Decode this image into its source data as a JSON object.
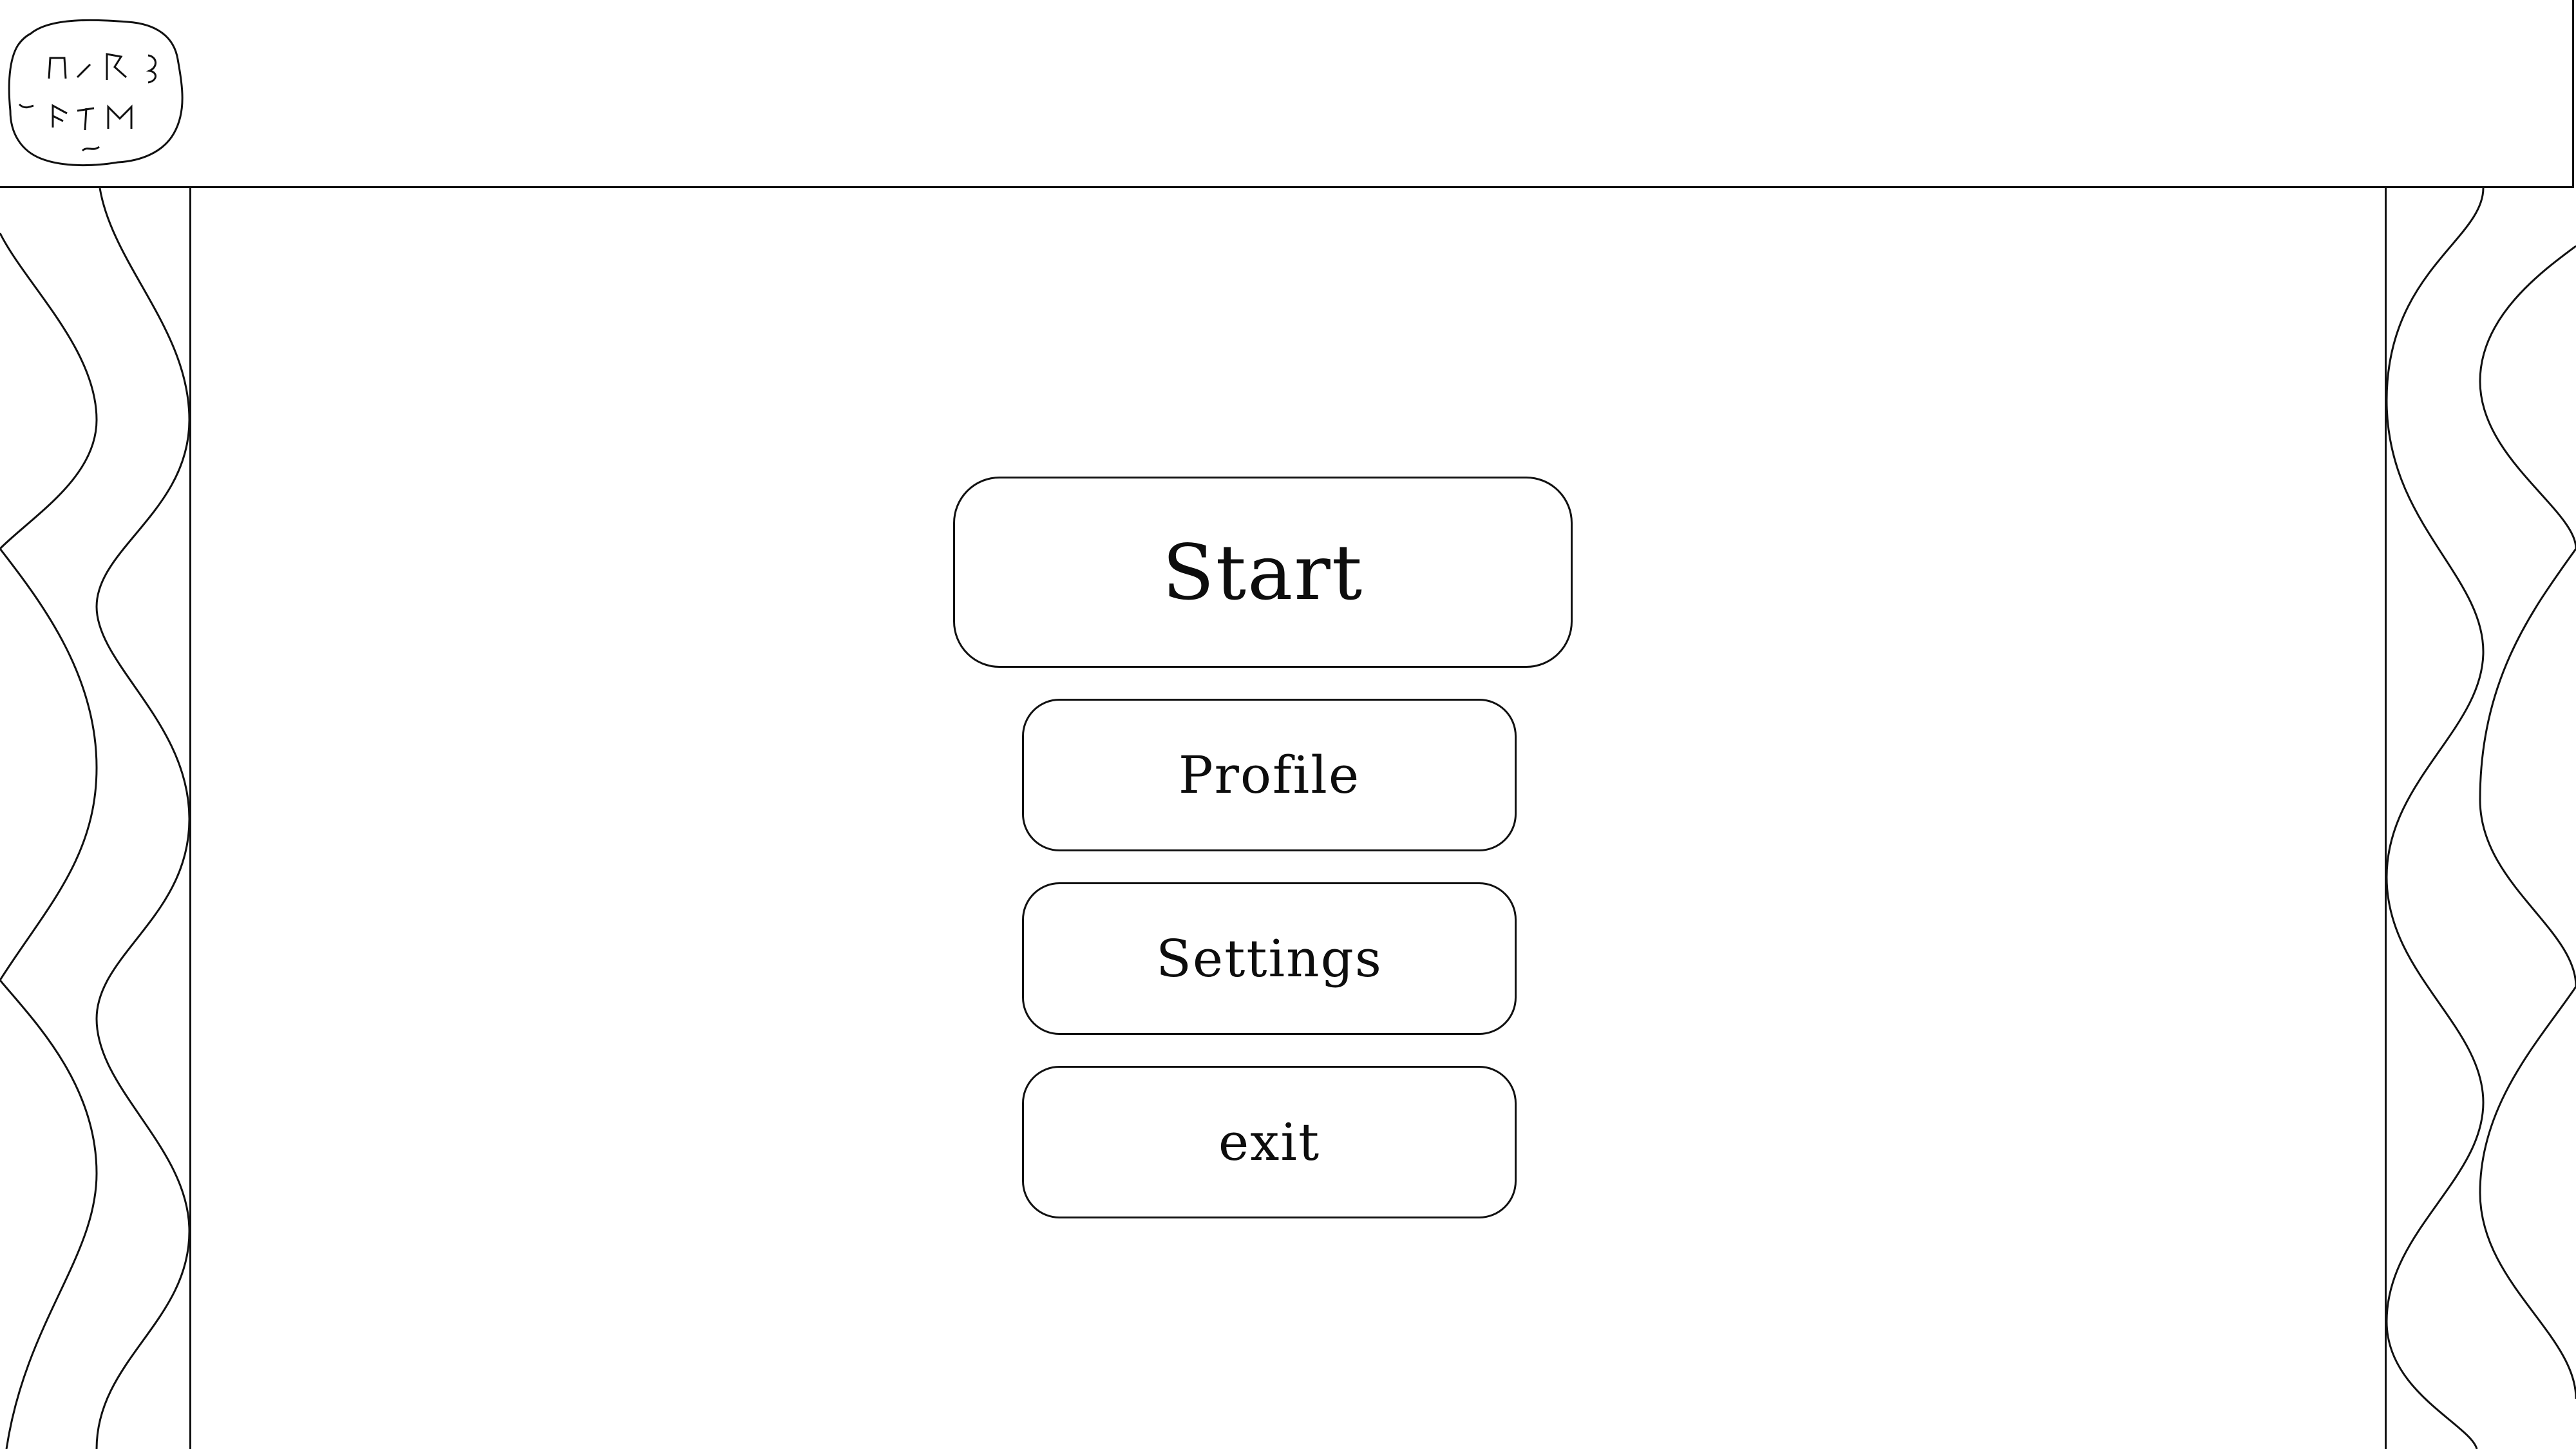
{
  "logo": {
    "icon": "runic-stone-logo-icon"
  },
  "decorations": {
    "left_icon": "wavy-pillar-icon",
    "right_icon": "wavy-pillar-icon"
  },
  "menu": {
    "start_label": "Start",
    "profile_label": "Profile",
    "settings_label": "Settings",
    "exit_label": "exit"
  },
  "colors": {
    "background": "#ffffff",
    "line": "#111111"
  }
}
